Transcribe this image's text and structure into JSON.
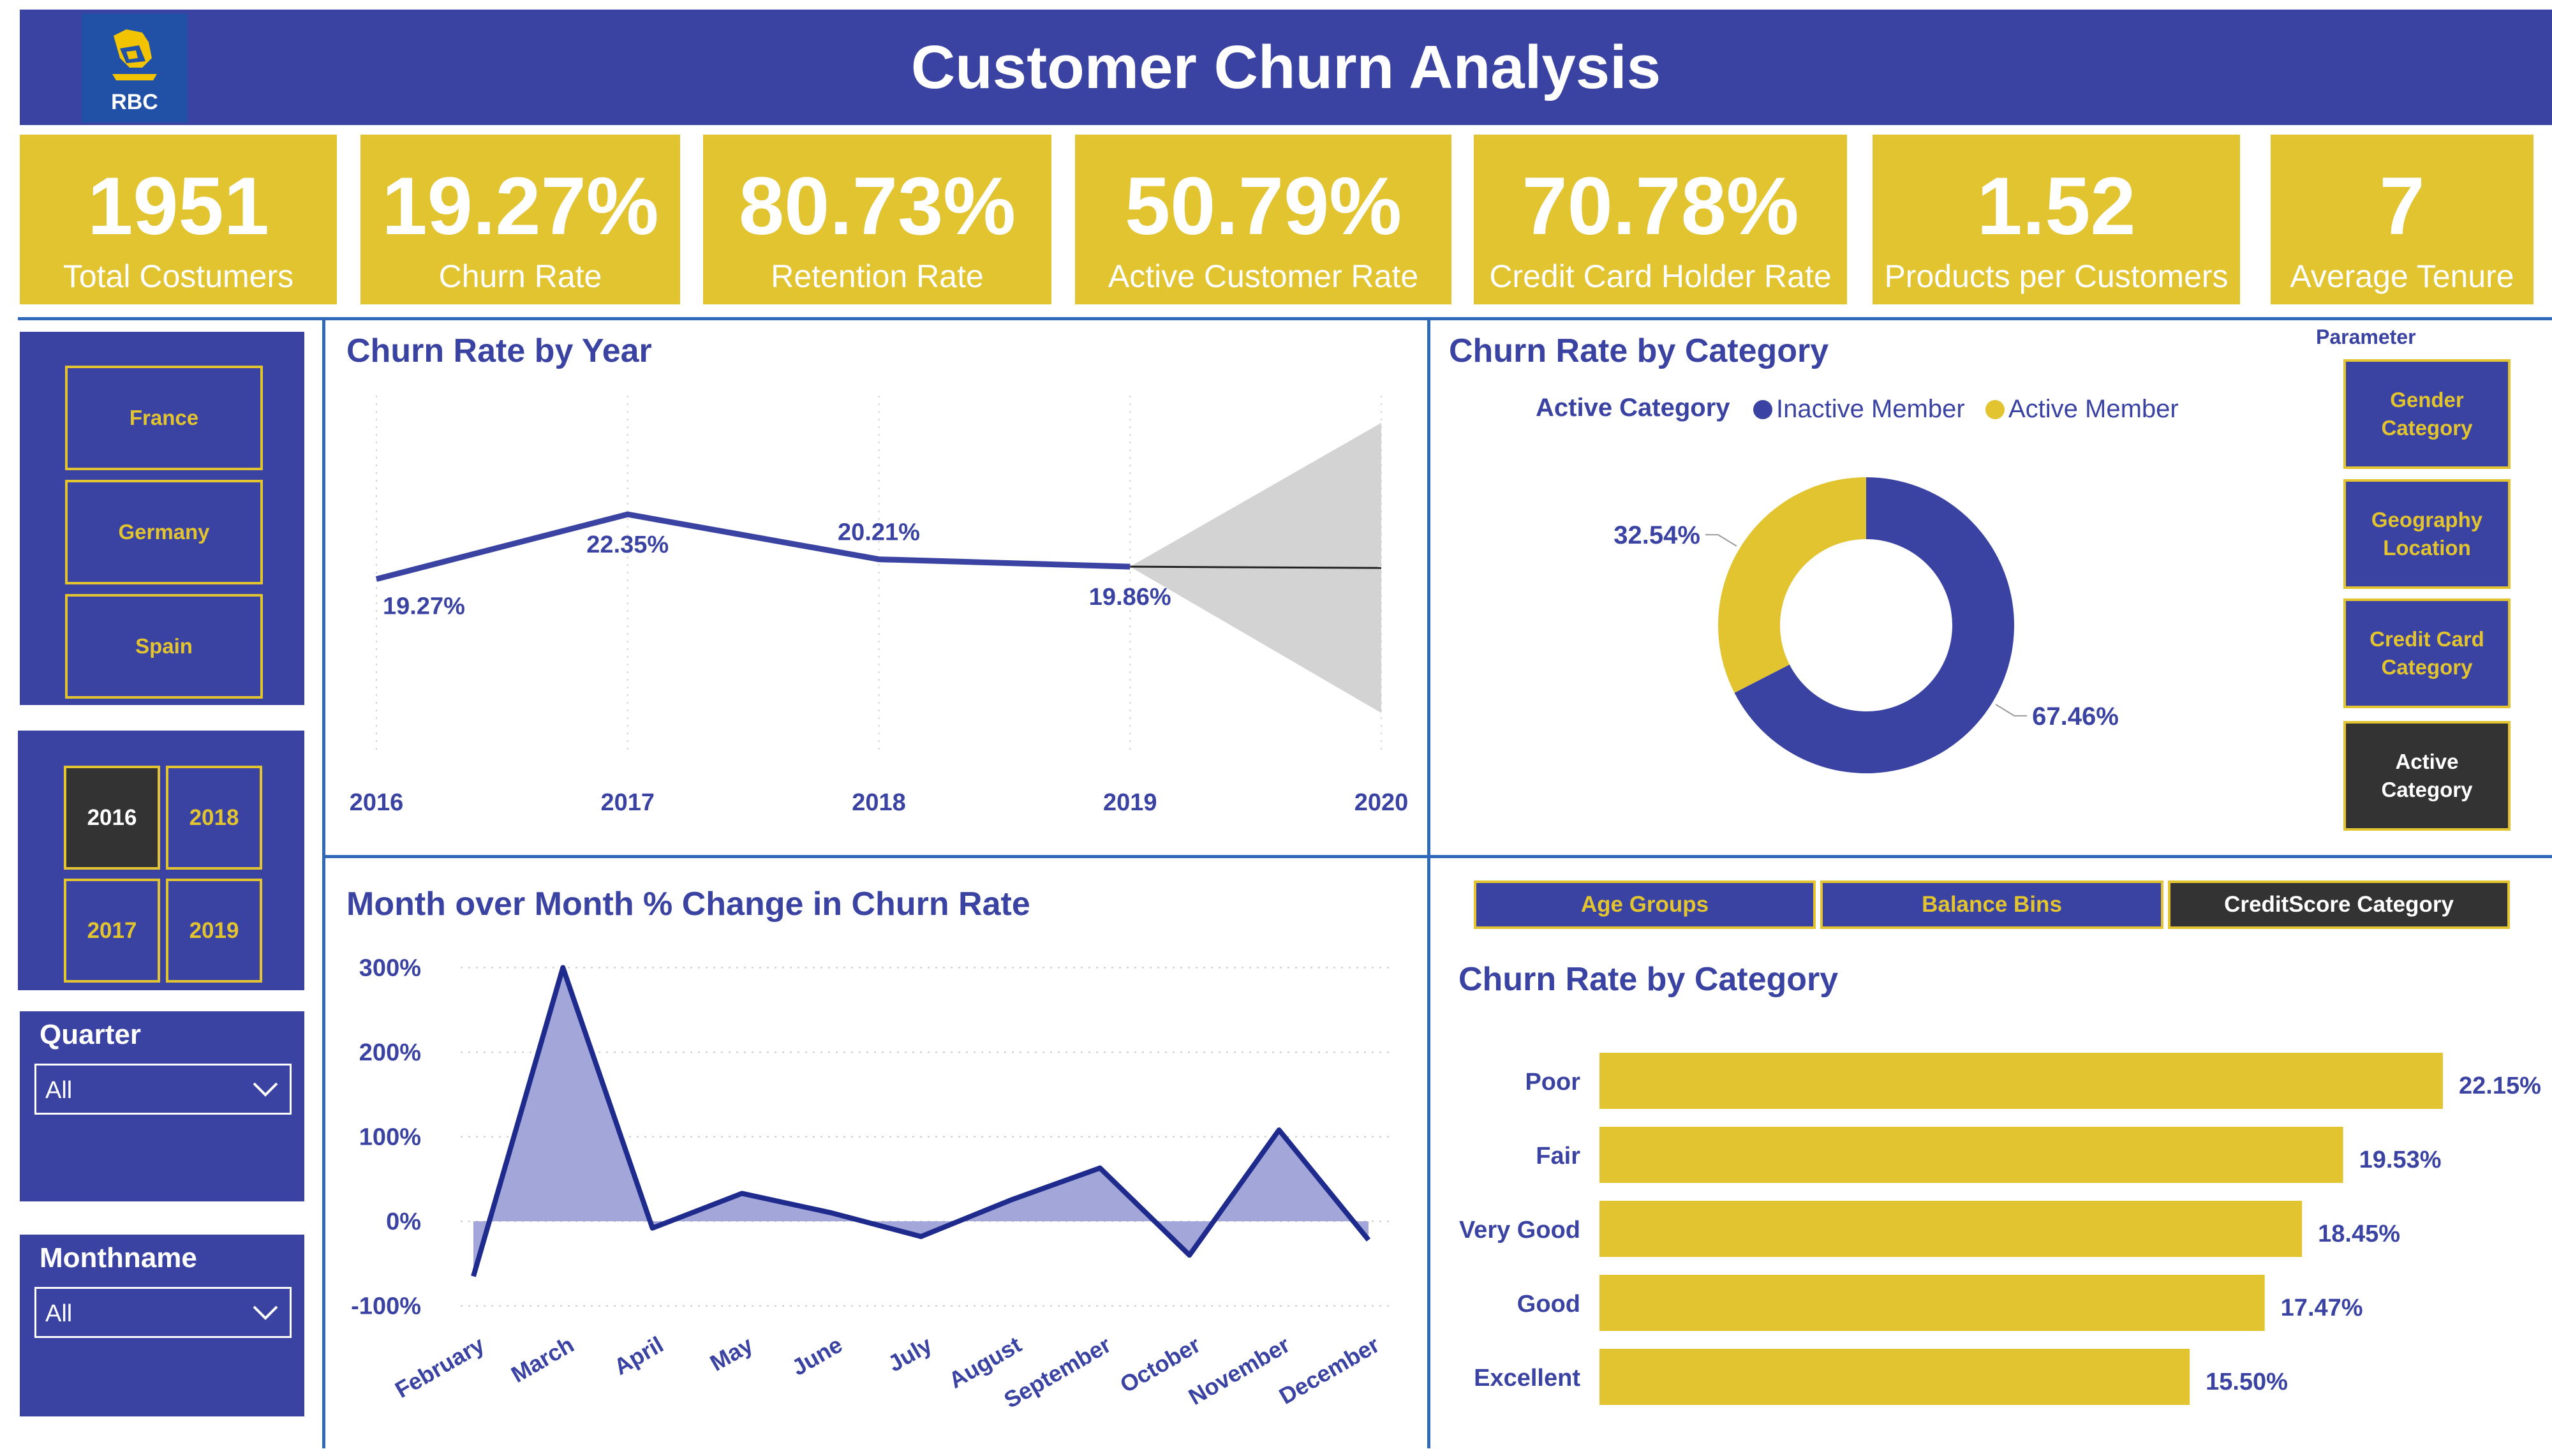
{
  "header": {
    "title": "Customer Churn Analysis",
    "logo_text": "RBC"
  },
  "kpis": [
    {
      "value": "1951",
      "label": "Total Costumers"
    },
    {
      "value": "19.27%",
      "label": "Churn Rate"
    },
    {
      "value": "80.73%",
      "label": "Retention Rate"
    },
    {
      "value": "50.79%",
      "label": "Active Customer Rate"
    },
    {
      "value": "70.78%",
      "label": "Credit Card Holder Rate"
    },
    {
      "value": "1.52",
      "label": "Products per Customers"
    },
    {
      "value": "7",
      "label": "Average Tenure"
    }
  ],
  "slicers": {
    "countries": [
      "France",
      "Germany",
      "Spain"
    ],
    "years": [
      "2016",
      "2018",
      "2017",
      "2019"
    ],
    "selected_year": "2016",
    "quarter": {
      "label": "Quarter",
      "value": "All"
    },
    "monthname": {
      "label": "Monthname",
      "value": "All"
    }
  },
  "parameter": {
    "label": "Parameter",
    "buttons": [
      "Gender\nCategory",
      "Geography\nLocation",
      "Credit Card\nCategory",
      "Active\nCategory"
    ],
    "selected": "Active\nCategory"
  },
  "bin_buttons": {
    "items": [
      "Age Groups",
      "Balance Bins",
      "CreditScore Category"
    ],
    "selected": "CreditScore Category"
  },
  "colors": {
    "primary": "#3a43a2",
    "accent": "#e2c330",
    "dark": "#333333",
    "divider": "#2f69b8"
  },
  "chart_data": [
    {
      "type": "line",
      "title": "Churn Rate by Year",
      "x": [
        "2016",
        "2017",
        "2018",
        "2019",
        "2020"
      ],
      "series": [
        {
          "values": [
            19.27,
            22.35,
            20.21,
            19.86,
            null
          ]
        }
      ],
      "data_labels": [
        "19.27%",
        "22.35%",
        "20.21%",
        "19.86%"
      ],
      "forecast": {
        "from": "2019",
        "to": "2020",
        "value_end": 19.8,
        "band_upper_end": 26.7,
        "band_lower_end": 12.9
      },
      "ylim": [
        11,
        28
      ]
    },
    {
      "type": "pie",
      "title": "Churn Rate by Category",
      "legend_title": "Active Category",
      "categories": [
        "Inactive Member",
        "Active Member"
      ],
      "values": [
        67.46,
        32.54
      ],
      "data_labels": [
        "67.46%",
        "32.54%"
      ],
      "colors": [
        "#3a43a2",
        "#e2c330"
      ]
    },
    {
      "type": "area",
      "title": "Month over Month % Change in Churn Rate",
      "categories": [
        "February",
        "March",
        "April",
        "May",
        "June",
        "July",
        "August",
        "September",
        "October",
        "November",
        "December"
      ],
      "values": [
        -65,
        300,
        -8,
        33,
        10,
        -18,
        25,
        63,
        -40,
        108,
        -22
      ],
      "yticks": [
        "300%",
        "200%",
        "100%",
        "0%",
        "-100%"
      ],
      "ylim": [
        -110,
        320
      ]
    },
    {
      "type": "bar",
      "title": "Churn Rate by Category",
      "categories": [
        "Poor",
        "Fair",
        "Very Good",
        "Good",
        "Excellent"
      ],
      "values": [
        22.15,
        19.53,
        18.45,
        17.47,
        15.5
      ],
      "data_labels": [
        "22.15%",
        "19.53%",
        "18.45%",
        "17.47%",
        "15.50%"
      ]
    }
  ]
}
